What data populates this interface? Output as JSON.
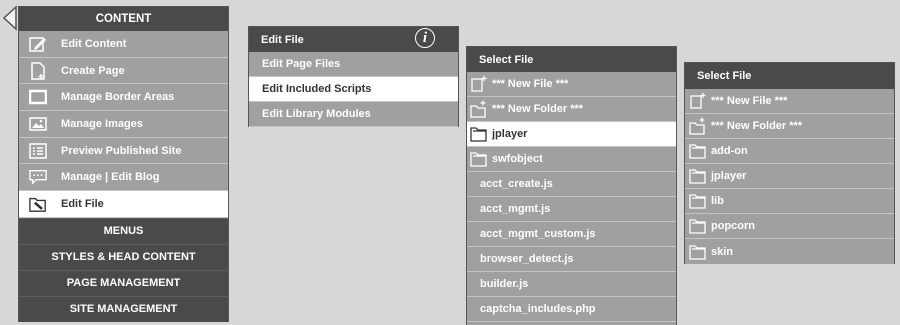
{
  "content_menu": {
    "header": "CONTENT",
    "items": [
      {
        "label": "Edit Content",
        "icon": "edit-pencil-icon"
      },
      {
        "label": "Create Page",
        "icon": "new-page-icon"
      },
      {
        "label": "Manage Border Areas",
        "icon": "border-areas-icon"
      },
      {
        "label": "Manage Images",
        "icon": "image-icon"
      },
      {
        "label": "Preview Published Site",
        "icon": "preview-list-icon"
      },
      {
        "label": "Manage | Edit Blog",
        "icon": "blog-speech-icon"
      },
      {
        "label": "Edit File",
        "icon": "edit-file-folder-icon",
        "active": true
      }
    ],
    "sections": [
      "MENUS",
      "STYLES & HEAD CONTENT",
      "PAGE MANAGEMENT",
      "SITE MANAGEMENT"
    ]
  },
  "edit_file_panel": {
    "header": "Edit File",
    "info_icon": "info-icon",
    "items": [
      "Edit Page Files",
      "Edit Included Scripts",
      "Edit Library Modules"
    ],
    "active_index": 1
  },
  "select_file_panel_1": {
    "header": "Select File",
    "new_file": "*** New File ***",
    "new_folder": "*** New Folder ***",
    "folders": [
      "jplayer",
      "swfobject"
    ],
    "active_folder": "jplayer",
    "files": [
      "acct_create.js",
      "acct_mgmt.js",
      "acct_mgmt_custom.js",
      "browser_detect.js",
      "builder.js",
      "captcha_includes.php"
    ]
  },
  "select_file_panel_2": {
    "header": "Select File",
    "new_file": "*** New File ***",
    "new_folder": "*** New Folder ***",
    "folders": [
      "add-on",
      "jplayer",
      "lib",
      "popcorn",
      "skin"
    ]
  },
  "colors": {
    "background": "#d7d7d7",
    "header": "#4a4a4a",
    "row": "#a0a0a0",
    "active_row": "#ffffff"
  }
}
